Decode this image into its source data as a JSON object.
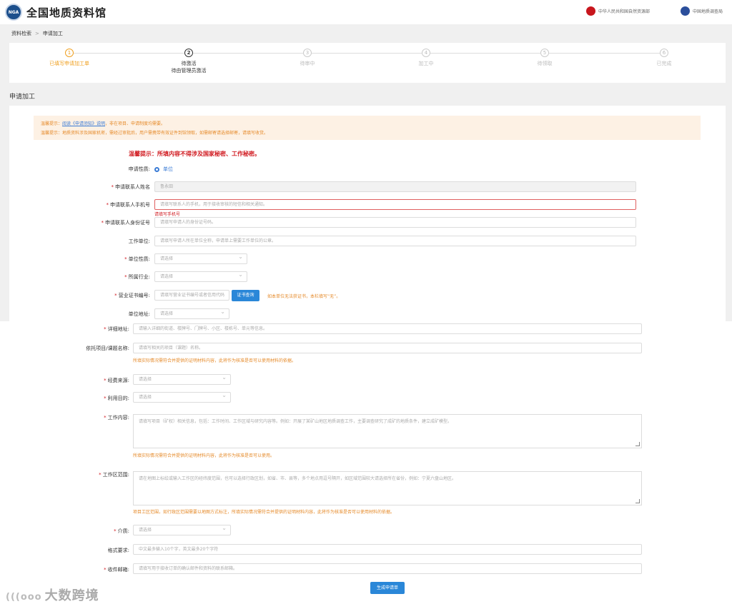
{
  "header": {
    "logo_text": "NGA",
    "title": "全国地质资料馆",
    "link1": "中华人民共和国自然资源部",
    "link2": "中国地质调查局"
  },
  "breadcrumb": {
    "item1": "资料检索",
    "item2": "申请加工"
  },
  "steps": [
    {
      "num": "1",
      "label": "已填写申请加工单"
    },
    {
      "num": "2",
      "label": "待激活",
      "label2": "待由管理员激活"
    },
    {
      "num": "3",
      "label": "待审中"
    },
    {
      "num": "4",
      "label": "加工中"
    },
    {
      "num": "5",
      "label": "待领取"
    },
    {
      "num": "6",
      "label": "已完成"
    }
  ],
  "section_title": "申请加工",
  "notice": {
    "line1_prefix": "温馨提示：",
    "line1_link": "阅读《申请须知》说明",
    "line1_suffix": "，非在项目、申请制度均需要。",
    "line2": "温馨提示：地质资料涉及国家机密，需经过审批后，用户需携带有效证件到馆领取，如需邮寄请选择邮寄，请填写收货。"
  },
  "warm": "温馨提示：所填内容不得涉及国家秘密、工作秘密。",
  "form": {
    "apply_type_label": "申请性质:",
    "apply_type_value": "单位",
    "name_label": "申请联系人姓名",
    "name_value": "鲁永田",
    "phone_label": "申请联系人手机号",
    "phone_placeholder": "请填写联系人的手机，用于接收审核的短信和相关通知。",
    "phone_error": "请填写手机号",
    "id_label": "申请联系人身份证号",
    "id_placeholder": "请填写申请人的身份证号码。",
    "unit_label": "工作单位:",
    "unit_placeholder": "请填写申请人所在单位全称，申请单上需要工作单位的公章。",
    "unit_type_label": "单位性质:",
    "unit_type_value": "请选择",
    "industry_label": "所属行业:",
    "industry_value": "请选择",
    "license_label": "营业证书编号:",
    "license_placeholder": "请填写营业证书编号或者信用代码",
    "license_btn": "证书查询",
    "license_hint": "如本单位无法获证书，本栏填写“无”。",
    "address_label": "单位地址:",
    "address_value": "请选择",
    "detail_label": "详细地址:",
    "detail_placeholder": "请输入详细的街道、楼牌号、门牌号、小区、楼栋号、单元等信息。",
    "project_label": "依托项目/课题名称:",
    "project_placeholder": "请填写相关的项目（课题）名称。",
    "project_hint": "所填实际情况需符合并提供的证明材料内容，此将作为核准是否可以使用材料的依据。",
    "source_label": "经费来源:",
    "source_value": "请选择",
    "purpose_label": "利用目的:",
    "purpose_value": "请选择",
    "content_label": "工作内容:",
    "content_placeholder": "请填写项目（矿权）相关信息，包括：工作时间、工作区域与研究内容等。例如：开展了某矿山地区地质调查工作，主要调查研究了成矿的地质条件，建立成矿模型。",
    "content_hint": "所填实际情况需符合并提供的证明材料内容，此将作为核准是否可以使用。",
    "area_label": "工作区范围:",
    "area_placeholder": "请在地图上标绘或输入工作区的经纬度范围，也可以选择行政区划，如省、市、县等，多个地点用逗号隔开，如区域范围较大请选择所在省份，例如：宁夏六盘山地区。",
    "area_hint": "项目工区范围，如行政区范围需要以地图方式标注，所填实际情况需符合并提供的证明材料内容，此将作为核准是否可以使用材料的依据。",
    "media_label": "介质:",
    "media_value": "请选择",
    "format_label": "格式要求:",
    "format_placeholder": "中文最多输入10个字，英文最多20个字符",
    "email_label": "收件邮箱:",
    "email_placeholder": "请填写用于接收订单的确认邮件和资料的联系邮箱。",
    "submit": "生成申请单"
  },
  "watermark": {
    "logo": "(((ooo",
    "text": "大数跨境"
  }
}
